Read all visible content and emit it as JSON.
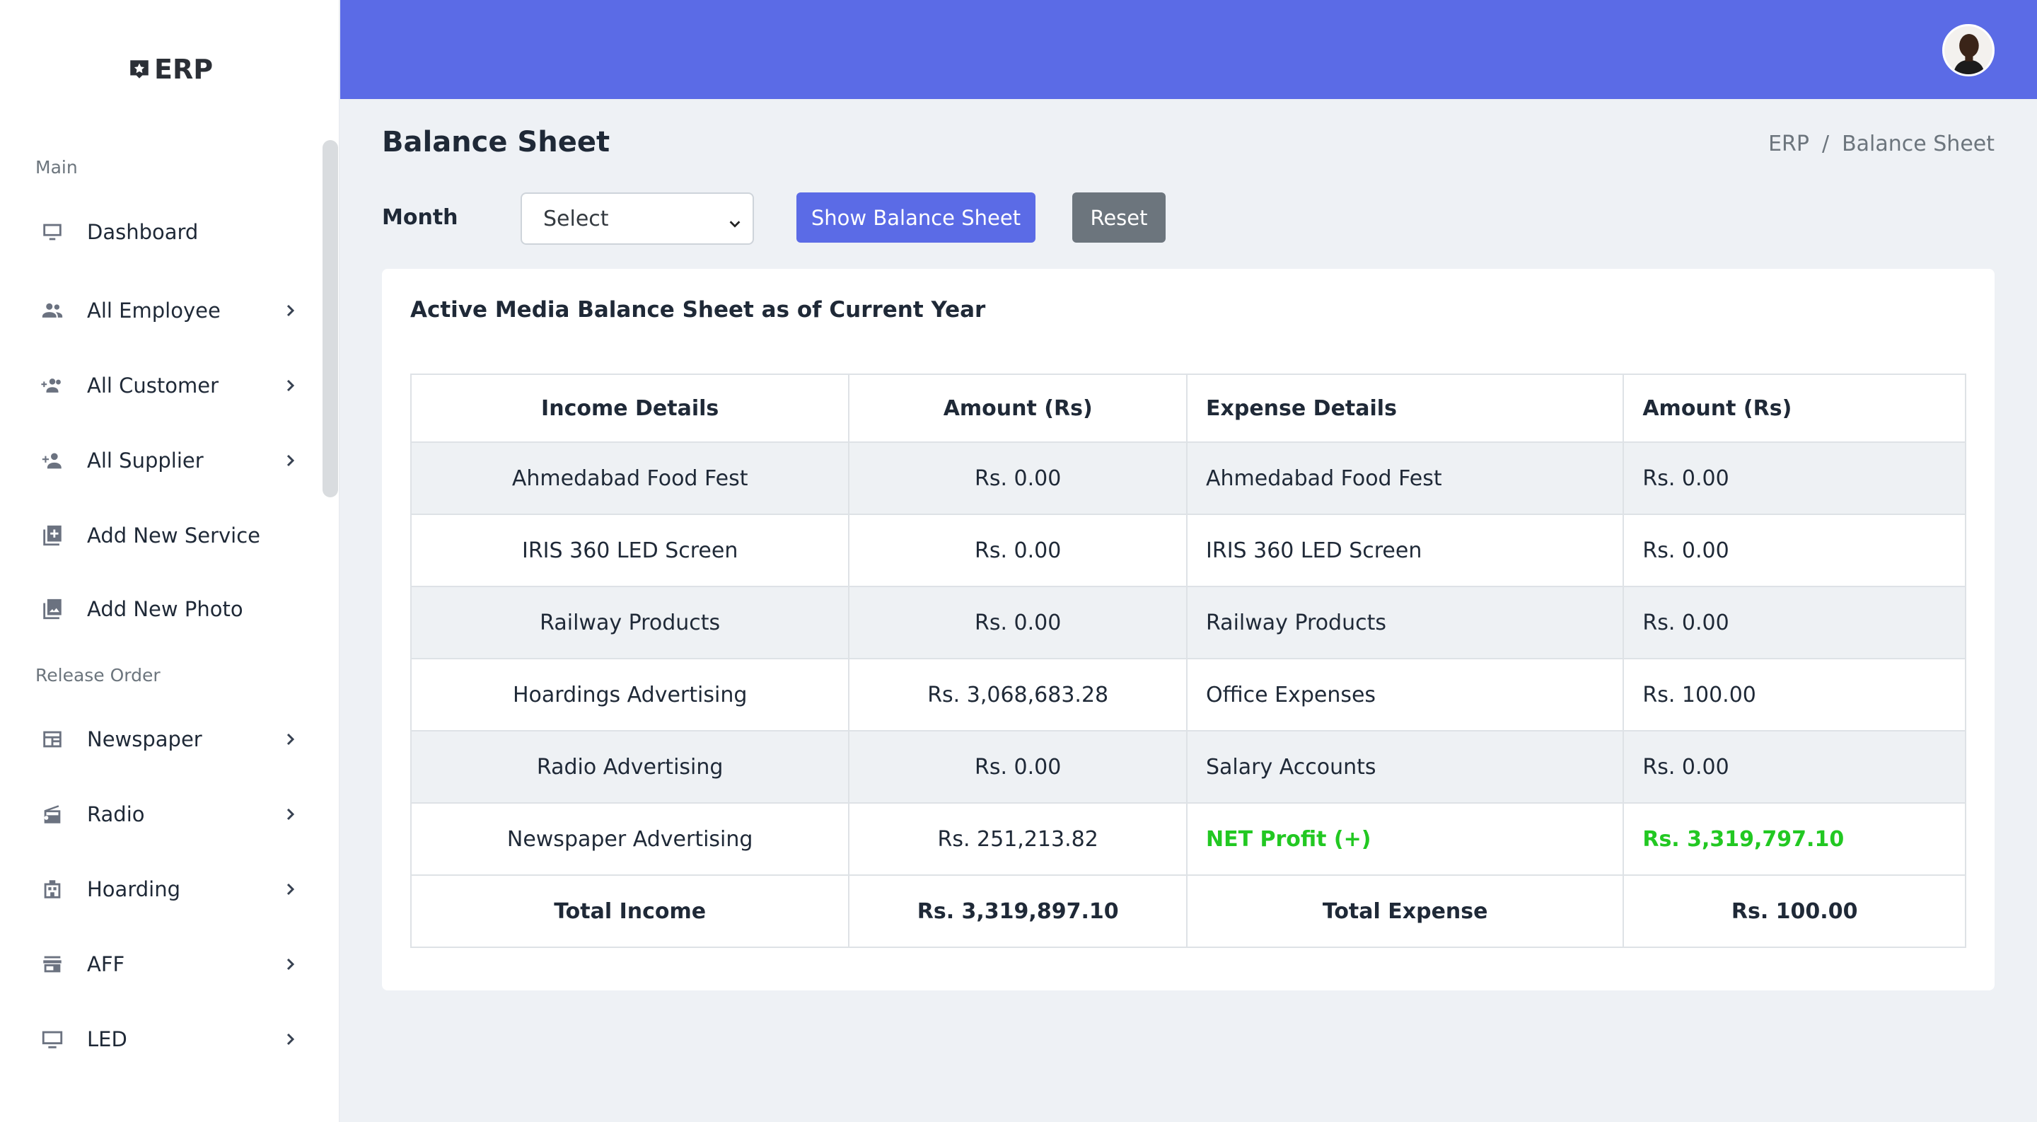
{
  "brand": {
    "name": "ERP"
  },
  "sidebar": {
    "sections": {
      "main": "Main",
      "release_order": "Release Order"
    },
    "items": [
      {
        "label": "Dashboard",
        "icon": "monitor-icon",
        "has_children": false
      },
      {
        "label": "All Employee",
        "icon": "people-icon",
        "has_children": true
      },
      {
        "label": "All Customer",
        "icon": "group-add-icon",
        "has_children": true
      },
      {
        "label": "All Supplier",
        "icon": "person-add-icon",
        "has_children": true
      },
      {
        "label": "Add New Service",
        "icon": "library-add-icon",
        "has_children": false
      },
      {
        "label": "Add New Photo",
        "icon": "photo-library-icon",
        "has_children": false
      },
      {
        "label": "Newspaper",
        "icon": "newspaper-icon",
        "has_children": true
      },
      {
        "label": "Radio",
        "icon": "radio-icon",
        "has_children": true
      },
      {
        "label": "Hoarding",
        "icon": "building-icon",
        "has_children": true
      },
      {
        "label": "AFF",
        "icon": "store-icon",
        "has_children": true
      },
      {
        "label": "LED",
        "icon": "desktop-icon",
        "has_children": true
      }
    ]
  },
  "header": {
    "title": "Balance Sheet",
    "breadcrumb": [
      "ERP",
      "/",
      "Balance Sheet"
    ]
  },
  "filter": {
    "month_label": "Month",
    "month_value": "Select",
    "show_button": "Show Balance Sheet",
    "reset_button": "Reset"
  },
  "card": {
    "title": "Active Media Balance Sheet as of Current Year",
    "columns": [
      "Income Details",
      "Amount (Rs)",
      "Expense Details",
      "Amount (Rs)"
    ],
    "rows": [
      [
        "Ahmedabad Food Fest",
        "Rs. 0.00",
        "Ahmedabad Food Fest",
        "Rs. 0.00"
      ],
      [
        "IRIS 360 LED Screen",
        "Rs. 0.00",
        "IRIS 360 LED Screen",
        "Rs. 0.00"
      ],
      [
        "Railway Products",
        "Rs. 0.00",
        "Railway Products",
        "Rs. 0.00"
      ],
      [
        "Hoardings Advertising",
        "Rs. 3,068,683.28",
        "Office Expenses",
        "Rs. 100.00"
      ],
      [
        "Radio Advertising",
        "Rs. 0.00",
        "Salary Accounts",
        "Rs. 0.00"
      ],
      [
        "Newspaper Advertising",
        "Rs. 251,213.82",
        "NET Profit (+)",
        "Rs. 3,319,797.10"
      ]
    ],
    "totals": [
      "Total Income",
      "Rs. 3,319,897.10",
      "Total Expense",
      "Rs. 100.00"
    ],
    "profit_color": "#22c822"
  },
  "colors": {
    "accent": "#5b6be6",
    "reset": "#6c757d"
  }
}
